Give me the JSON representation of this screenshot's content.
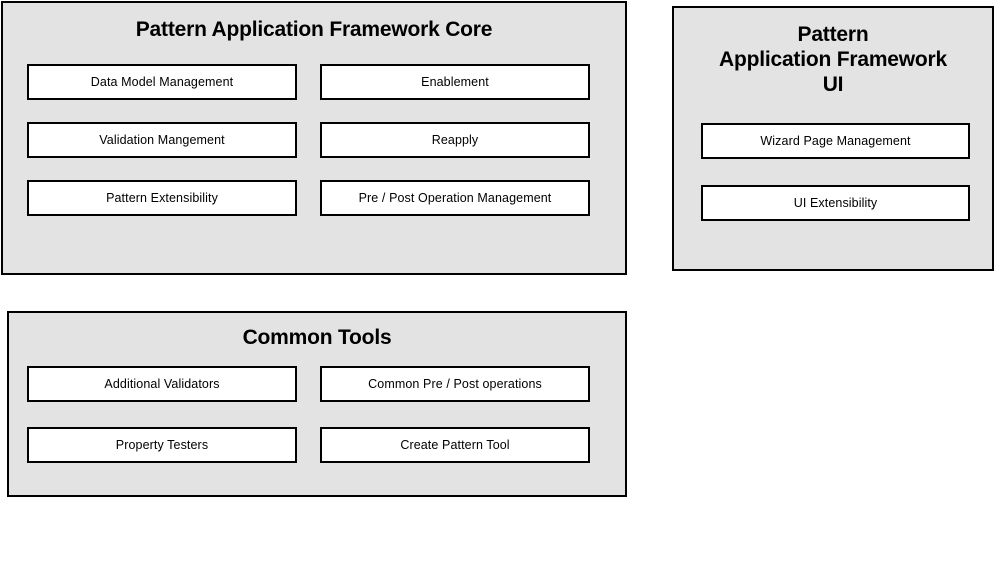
{
  "colors": {
    "panel_background": "#e3e3e3",
    "cell_background": "#ffffff",
    "border": "#000000",
    "text": "#000000",
    "page_background": "#ffffff"
  },
  "panels": [
    {
      "id": "pattern-application-framework-core",
      "title": "Pattern Application Framework Core",
      "title_lines": [
        "Pattern Application Framework Core"
      ],
      "cells": [
        {
          "label": "Data Model Management"
        },
        {
          "label": "Enablement"
        },
        {
          "label": "Validation Mangement"
        },
        {
          "label": "Reapply"
        },
        {
          "label": "Pattern Extensibility"
        },
        {
          "label": "Pre / Post Operation Management"
        }
      ]
    },
    {
      "id": "pattern-application-framework-ui",
      "title": "Pattern Application Framework UI",
      "title_lines": [
        "Pattern",
        "Application Framework",
        "UI"
      ],
      "cells": [
        {
          "label": "Wizard Page Management"
        },
        {
          "label": "UI Extensibility"
        }
      ]
    },
    {
      "id": "common-tools",
      "title": "Common Tools",
      "title_lines": [
        "Common Tools"
      ],
      "cells": [
        {
          "label": "Additional Validators"
        },
        {
          "label": "Common Pre / Post operations"
        },
        {
          "label": "Property Testers"
        },
        {
          "label": "Create Pattern Tool"
        }
      ]
    }
  ]
}
